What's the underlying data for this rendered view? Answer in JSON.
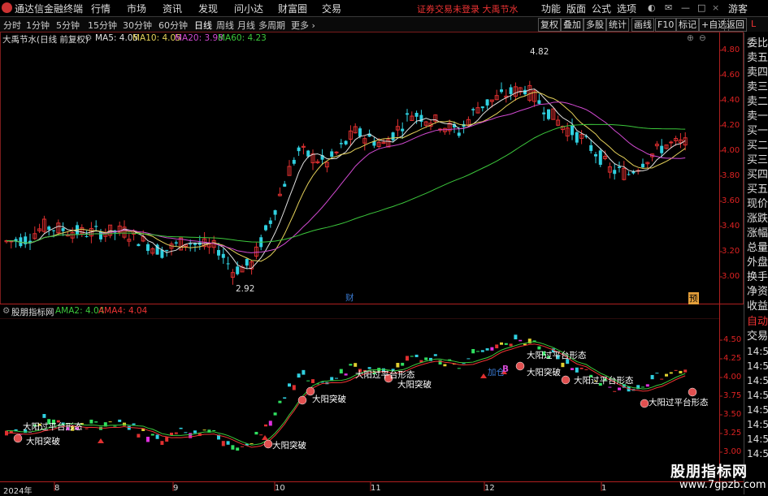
{
  "titlebar": {
    "app_name": "通达信金融终端",
    "menus": [
      "行情",
      "市场",
      "资讯",
      "发现",
      "问小达",
      "财富圈",
      "交易"
    ],
    "warning": "证券交易未登录  大禹节水",
    "right_items": [
      "功能",
      "版面",
      "公式",
      "选项"
    ],
    "user": "游客"
  },
  "tabbar": {
    "tabs": [
      "分时",
      "1分钟",
      "5分钟",
      "15分钟",
      "30分钟",
      "60分钟",
      "日线",
      "周线",
      "月线",
      "多周期",
      "更多 ›"
    ],
    "active": "日线",
    "right_buttons": [
      "复权",
      "叠加",
      "多股",
      "统计",
      "画线",
      "F10",
      "标记",
      "+自选",
      "返回"
    ],
    "corner_label": "L"
  },
  "main_chart": {
    "stock_name": "大禹节水(日线 前复权)",
    "ma": [
      {
        "label": "MA5: 4.05",
        "color": "#e0e0e0"
      },
      {
        "label": "MA10: 4.05",
        "color": "#e6d25a"
      },
      {
        "label": "MA20: 3.98",
        "color": "#d24ad2"
      },
      {
        "label": "MA60: 4.23",
        "color": "#3cc83c"
      }
    ],
    "y_ticks": [
      "4.80",
      "4.60",
      "4.40",
      "4.20",
      "4.00",
      "3.80",
      "3.60",
      "3.40",
      "3.20",
      "3.00"
    ],
    "high_label": "4.82",
    "low_label": "2.92",
    "badge_cai": "财",
    "badge_yu": "预"
  },
  "indicator_chart": {
    "name": "股朋指标网",
    "ama": [
      {
        "label": "AMA2: 4.04",
        "color": "#3cc83c"
      },
      {
        "label": "AMA4: 4.04",
        "color": "#e33"
      }
    ],
    "y_ticks": [
      "4.50",
      "4.25",
      "4.00",
      "3.75",
      "3.50",
      "3.25",
      "3.00"
    ],
    "annotations": [
      "大阳过平台形态",
      "大阳突破",
      "大阳过平台形态",
      "大阳突破",
      "大阳过平台形态",
      "大阳突破",
      "大阳过平台形态",
      "大阳突破",
      "大阳过平台形态",
      "加仓",
      "B"
    ]
  },
  "right_side": [
    "委比",
    "卖五",
    "卖四",
    "卖三",
    "卖二",
    "卖一",
    "买一",
    "买二",
    "买三",
    "买四",
    "买五",
    "现价",
    "涨跌",
    "涨幅",
    "总量",
    "外盘",
    "换手",
    "净资",
    "收益",
    "自动",
    "交易",
    "14:5",
    "14:5",
    "14:5",
    "14:5",
    "14:5",
    "14:5",
    "14:5",
    "14:5"
  ],
  "x_axis": [
    "2024年",
    "8",
    "9",
    "10",
    "11",
    "12",
    "1"
  ],
  "watermark": {
    "line1": "股朋指标网",
    "line2": "www.7gpzb.com"
  },
  "colors": {
    "up": "#e03030",
    "down": "#30d0e0",
    "ma5": "#e0e0e0",
    "ma10": "#e6d25a",
    "ma20": "#d24ad2",
    "ma60": "#3cc83c"
  }
}
